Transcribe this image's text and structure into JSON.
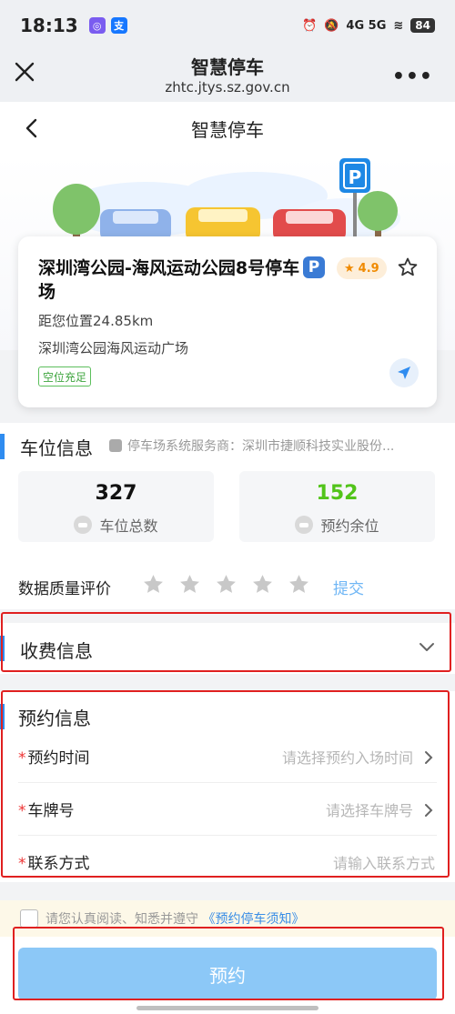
{
  "status_bar": {
    "time": "18:13",
    "network": "4G 5G",
    "battery": "84"
  },
  "browser": {
    "title": "智慧停车",
    "url": "zhtc.jtys.sz.gov.cn"
  },
  "page": {
    "title": "智慧停车"
  },
  "parking": {
    "name": "深圳湾公园-海风运动公园8号停车场",
    "p_badge": "P",
    "rating": "4.9",
    "distance": "距您位置24.85km",
    "address": "深圳湾公园海风运动广场",
    "vacancy": "空位充足"
  },
  "space_info": {
    "title": "车位信息",
    "provider": "停车场系统服务商：深圳市捷顺科技实业股份...",
    "total_value": "327",
    "total_label": "车位总数",
    "remaining_value": "152",
    "remaining_label": "预约余位",
    "quality_label": "数据质量评价",
    "rating_stars": 0,
    "submit": "提交"
  },
  "fee": {
    "title": "收费信息"
  },
  "reservation": {
    "title": "预约信息",
    "time_label": "预约时间",
    "time_placeholder": "请选择预约入场时间",
    "plate_label": "车牌号",
    "plate_placeholder": "请选择车牌号",
    "contact_label": "联系方式",
    "contact_placeholder": "请输入联系方式",
    "required_mark": "*"
  },
  "agreement": {
    "text": "请您认真阅读、知悉并遵守",
    "link": "《预约停车须知》"
  },
  "button": {
    "reserve": "预约"
  },
  "colors": {
    "accent": "#2f8cf0",
    "success": "#52c41a",
    "reserve_button": "#8cc8f7",
    "highlight": "#e02020"
  }
}
